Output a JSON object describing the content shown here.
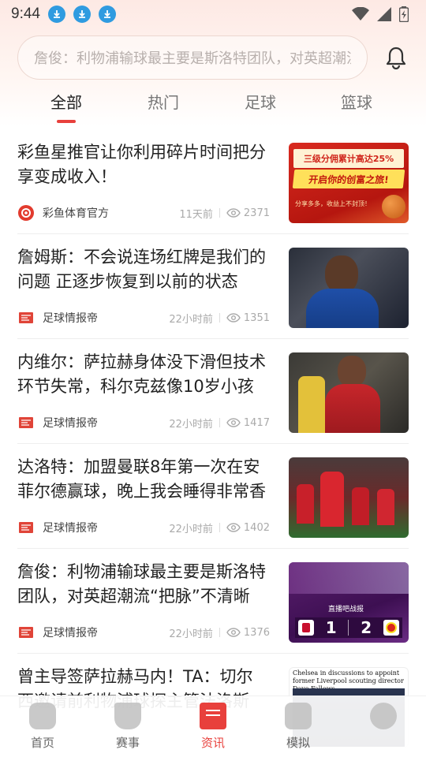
{
  "status": {
    "time": "9:44"
  },
  "search": {
    "placeholder": "詹俊：利物浦输球最主要是斯洛特团队，对英超潮流“把脉”不清晰"
  },
  "tabs": [
    {
      "label": "全部"
    },
    {
      "label": "热门"
    },
    {
      "label": "足球"
    },
    {
      "label": "篮球"
    }
  ],
  "news": [
    {
      "title": "彩鱼星推官让你利用碎片时间把分享变成收入！",
      "source": "彩鱼体育官方",
      "time": "11天前",
      "views": "2371",
      "thumb": {
        "line1": "三级分佣累计高达25%",
        "line2": "开启你的创富之旅!",
        "line3": "分享多多，收益上不封顶！"
      }
    },
    {
      "title": "詹姆斯：不会说连场红牌是我们的问题 正逐步恢复到以前的状态",
      "source": "足球情报帝",
      "time": "22小时前",
      "views": "1351"
    },
    {
      "title": "内维尔：萨拉赫身体没下滑但技术环节失常，科尔克兹像10岁小孩",
      "source": "足球情报帝",
      "time": "22小时前",
      "views": "1417"
    },
    {
      "title": "达洛特：加盟曼联8年第一次在安菲尔德赢球，晚上我会睡得非常香",
      "source": "足球情报帝",
      "time": "22小时前",
      "views": "1402"
    },
    {
      "title": "詹俊：利物浦输球最主要是斯洛特团队，对英超潮流“把脉”不清晰",
      "source": "足球情报帝",
      "time": "22小时前",
      "views": "1376",
      "thumb": {
        "label": "直播吧战报",
        "score_home": "1",
        "score_away": "2"
      }
    },
    {
      "title": "曾主导签萨拉赫马内！TA：切尔西邀请前利物浦球探主管法洛斯",
      "thumb": {
        "caption": "Chelsea in discussions to appoint former Liverpool scouting director Dave Fallows"
      }
    }
  ],
  "bottom_nav": [
    {
      "label": "首页"
    },
    {
      "label": "赛事"
    },
    {
      "label": "资讯"
    },
    {
      "label": "模拟"
    },
    {
      "label": ""
    }
  ],
  "colors": {
    "accent": "#e8403c",
    "download_icon": "#2f9be0"
  }
}
